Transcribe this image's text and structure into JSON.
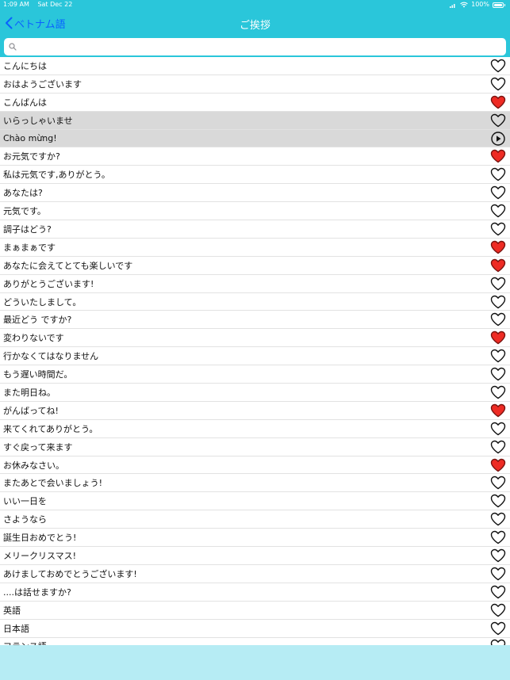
{
  "status": {
    "time": "1:09 AM",
    "date": "Sat Dec 22",
    "battery": "100%"
  },
  "nav": {
    "back_label": "ベトナム語",
    "title": "ご挨拶"
  },
  "search": {
    "placeholder": "",
    "value": ""
  },
  "colors": {
    "bar": "#2ac6da",
    "accent": "#0a62ff",
    "heart_fav": "#ee2b24",
    "selected_bg": "#d9d9d9"
  },
  "phrases": [
    {
      "text": "こんにちは",
      "favorite": false
    },
    {
      "text": "おはようございます",
      "favorite": false
    },
    {
      "text": "こんばんは",
      "favorite": true
    },
    {
      "text": "いらっしゃいませ",
      "favorite": false,
      "selected": true
    },
    {
      "text": "Chào mừng!",
      "answer": true
    },
    {
      "text": "お元気ですか?",
      "favorite": true
    },
    {
      "text": "私は元気です,ありがとう。",
      "favorite": false
    },
    {
      "text": "あなたは?",
      "favorite": false
    },
    {
      "text": "元気です。",
      "favorite": false
    },
    {
      "text": "調子はどう?",
      "favorite": false
    },
    {
      "text": "まぁまぁです",
      "favorite": true
    },
    {
      "text": "あなたに会えてとても楽しいです",
      "favorite": true
    },
    {
      "text": "ありがとうございます!",
      "favorite": false
    },
    {
      "text": "どういたしまして。",
      "favorite": false
    },
    {
      "text": "最近どう ですか?",
      "favorite": false
    },
    {
      "text": "変わりないです",
      "favorite": true
    },
    {
      "text": "行かなくてはなりません",
      "favorite": false
    },
    {
      "text": "もう遅い時間だ。",
      "favorite": false
    },
    {
      "text": "また明日ね。",
      "favorite": false
    },
    {
      "text": "がんばってね!",
      "favorite": true
    },
    {
      "text": "来てくれてありがとう。",
      "favorite": false
    },
    {
      "text": "すぐ戻って来ます",
      "favorite": false
    },
    {
      "text": "お休みなさい。",
      "favorite": true
    },
    {
      "text": "またあとで会いましょう!",
      "favorite": false
    },
    {
      "text": "いい一日を",
      "favorite": false
    },
    {
      "text": "さようなら",
      "favorite": false
    },
    {
      "text": "誕生日おめでとう!",
      "favorite": false
    },
    {
      "text": "メリークリスマス!",
      "favorite": false
    },
    {
      "text": "あけましておめでとうございます!",
      "favorite": false
    },
    {
      "text": "....は話せますか?",
      "favorite": false
    },
    {
      "text": "英語",
      "favorite": false
    },
    {
      "text": "日本語",
      "favorite": false
    },
    {
      "text": "フランス語",
      "favorite": false
    }
  ]
}
